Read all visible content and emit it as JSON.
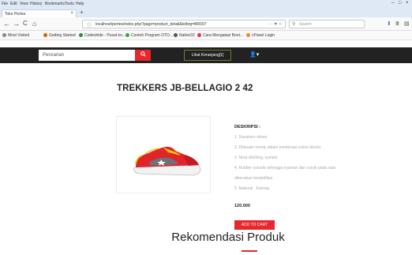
{
  "menu": [
    "File",
    "Edit",
    "View",
    "History",
    "Bookmarks",
    "Tools",
    "Help"
  ],
  "window_controls": [
    "–",
    "□",
    "×"
  ],
  "tab": {
    "title": "Toko Pertes",
    "close": "×",
    "new_tab": "+"
  },
  "nav": {
    "back": "←",
    "forward": "→",
    "reload": "C",
    "home": "⌂",
    "url": "localhost/pertes/index.php?page=product_detail&kdbrg=BR007",
    "url_tools": "··· ♥ ☆",
    "search_placeholder": "Search"
  },
  "bookmarks": [
    {
      "label": "Most Visited",
      "color": "#888888"
    },
    {
      "label": "Getting Started",
      "color": "#e66000"
    },
    {
      "label": "Codeshide - Pusat ko...",
      "color": "#2c8e3a"
    },
    {
      "label": "Contoh Program OTO...",
      "color": "#3ca83c"
    },
    {
      "label": "Native32",
      "color": "#555555"
    },
    {
      "label": "Cara Mengatasi Boot...",
      "color": "#e03c3c"
    },
    {
      "label": "cPanel Login",
      "color": "#f08c1e"
    }
  ],
  "site": {
    "search_placeholder": "Pencarian",
    "search_icon": "🔍",
    "cart_label": "Lihat Keranjang[1]",
    "user_icon": "👤▾"
  },
  "product": {
    "title": "TREKKERS JB-BELLAGIO 2 42",
    "desc_heading": "DESKRIPSI :",
    "desc_lines": [
      "1. Sneakers shoes",
      "2. Didesain trendy dalam kombinasi colors blocks",
      "3. Neat stitching, eyelets",
      "4. Rubber outsole sehingga nyaman dan cocok pada saat",
      "dikenakan beraktifitas",
      "5. Material : Kanvas"
    ],
    "price": "120.000",
    "add_to_cart": "ADD TO CART"
  },
  "recommend_heading": "Rekomendasi Produk",
  "colors": {
    "accent": "#e8262b",
    "header_bg": "#222222"
  }
}
